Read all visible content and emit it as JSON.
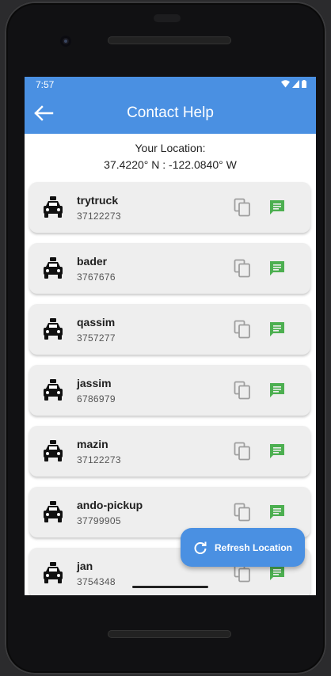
{
  "status_bar": {
    "time": "7:57"
  },
  "app_bar": {
    "title": "Contact Help",
    "back_icon": "arrow-left-icon"
  },
  "location": {
    "label": "Your Location:",
    "coordinates": "37.4220° N : -122.0840° W"
  },
  "contacts": [
    {
      "name": "trytruck",
      "phone": "37122273"
    },
    {
      "name": "bader",
      "phone": "3767676"
    },
    {
      "name": "qassim",
      "phone": "3757277"
    },
    {
      "name": "jassim",
      "phone": "6786979"
    },
    {
      "name": "mazin",
      "phone": "37122273"
    },
    {
      "name": "ando-pickup",
      "phone": "37799905"
    },
    {
      "name": "jan",
      "phone": "3754348"
    }
  ],
  "fab": {
    "label": "Refresh Location",
    "icon": "refresh-icon"
  },
  "colors": {
    "primary": "#4a90e2",
    "card_bg": "#eeeeee",
    "message_green": "#4caf50",
    "copy_grey": "#9e9e9e"
  }
}
